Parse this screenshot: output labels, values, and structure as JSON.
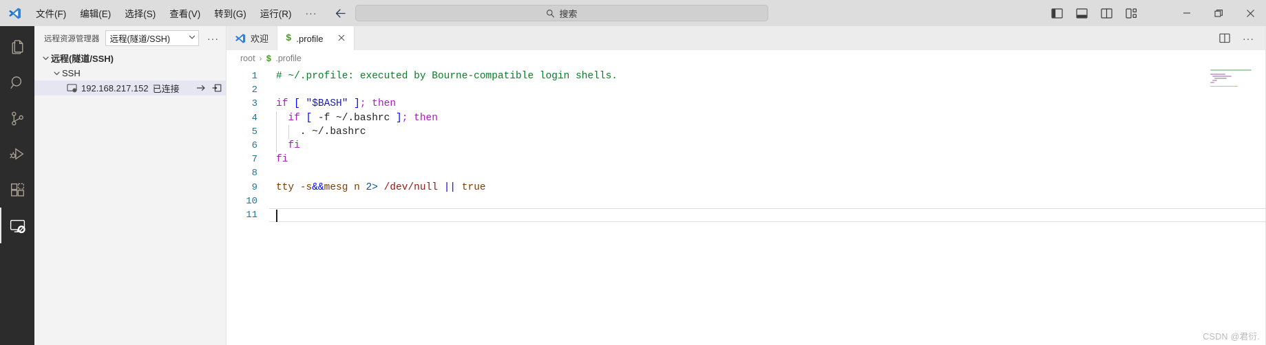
{
  "titlebar": {
    "logo_icon": "vscode-logo-icon",
    "menu": [
      {
        "label": "文件(F)",
        "name": "menu-file"
      },
      {
        "label": "编辑(E)",
        "name": "menu-edit"
      },
      {
        "label": "选择(S)",
        "name": "menu-selection"
      },
      {
        "label": "查看(V)",
        "name": "menu-view"
      },
      {
        "label": "转到(G)",
        "name": "menu-goto"
      },
      {
        "label": "运行(R)",
        "name": "menu-run"
      }
    ],
    "overflow_label": "···",
    "nav": {
      "back_icon": "arrow-left-icon",
      "forward_icon": "arrow-right-icon"
    },
    "search": {
      "placeholder": "搜索",
      "value": "",
      "icon": "search-icon"
    },
    "layout_icons": [
      {
        "name": "toggle-primary-sidebar-icon"
      },
      {
        "name": "toggle-panel-icon"
      },
      {
        "name": "toggle-secondary-sidebar-icon"
      },
      {
        "name": "customize-layout-icon"
      }
    ],
    "window_controls": {
      "minimize": "minimize-icon",
      "restore": "restore-icon",
      "close": "close-icon"
    }
  },
  "activitybar": {
    "items": [
      {
        "name": "activity-explorer",
        "icon": "files-icon",
        "active": false
      },
      {
        "name": "activity-search",
        "icon": "search-icon",
        "active": false
      },
      {
        "name": "activity-source-control",
        "icon": "source-control-icon",
        "active": false
      },
      {
        "name": "activity-run-debug",
        "icon": "run-debug-icon",
        "active": false
      },
      {
        "name": "activity-extensions",
        "icon": "extensions-icon",
        "active": false
      },
      {
        "name": "activity-remote-explorer",
        "icon": "remote-explorer-icon",
        "active": true
      }
    ]
  },
  "sidebar": {
    "title": "远程资源管理器",
    "selector": {
      "value": "远程(隧道/SSH)",
      "chevron_icon": "chevron-down-icon"
    },
    "more_actions_label": "···",
    "tree": {
      "root": {
        "label": "远程(隧道/SSH)",
        "expanded": true
      },
      "group": {
        "label": "SSH",
        "expanded": true
      },
      "host": {
        "label": "192.168.217.152",
        "status": "已连接",
        "selected": true,
        "icon": "remote-host-icon",
        "actions": [
          {
            "name": "connect-in-current-window-icon"
          },
          {
            "name": "connect-in-new-window-icon"
          }
        ]
      }
    }
  },
  "editor": {
    "tabs": [
      {
        "label": "欢迎",
        "icon": "vscode-welcome-icon",
        "active": false,
        "closable": false
      },
      {
        "label": ".profile",
        "icon": "shell-dollar-icon",
        "active": true,
        "closable": true,
        "close_icon": "close-icon"
      }
    ],
    "tabbar_actions": [
      {
        "name": "split-editor-icon"
      },
      {
        "name": "more-actions-icon",
        "label": "···"
      }
    ],
    "breadcrumb": {
      "root": "root",
      "separator": "›",
      "file_icon": "shell-dollar-icon",
      "file": ".profile"
    },
    "language": "shellscript",
    "line_numbers": [
      "1",
      "2",
      "3",
      "4",
      "5",
      "6",
      "7",
      "8",
      "9",
      "10",
      "11"
    ],
    "cursor_line": 11,
    "lines": [
      {
        "n": 1,
        "text": "# ~/.profile: executed by Bourne-compatible login shells."
      },
      {
        "n": 2,
        "text": ""
      },
      {
        "n": 3,
        "text": "if [ \"$BASH\" ]; then"
      },
      {
        "n": 4,
        "text": "  if [ -f ~/.bashrc ]; then"
      },
      {
        "n": 5,
        "text": "    . ~/.bashrc"
      },
      {
        "n": 6,
        "text": "  fi"
      },
      {
        "n": 7,
        "text": "fi"
      },
      {
        "n": 8,
        "text": ""
      },
      {
        "n": 9,
        "text": "tty -s&&mesg n 2> /dev/null || true"
      },
      {
        "n": 10,
        "text": ""
      },
      {
        "n": 11,
        "text": ""
      }
    ]
  },
  "watermark": {
    "text": "CSDN @君衍."
  },
  "colors": {
    "titlebar_bg": "#dddddd",
    "activitybar_bg": "#2c2c2c",
    "sidebar_bg": "#f3f3f3",
    "tabbar_bg": "#ececec",
    "editor_bg": "#ffffff",
    "selection_bg": "#e4e6f1",
    "line_number_fg": "#237893",
    "comment_fg": "#0a7d26",
    "keyword_fg": "#a81bbf",
    "string_fg": "#1a1aa8",
    "path_fg": "#a31515",
    "accent": "#0078d4",
    "dollar_green": "#4a9c27"
  }
}
